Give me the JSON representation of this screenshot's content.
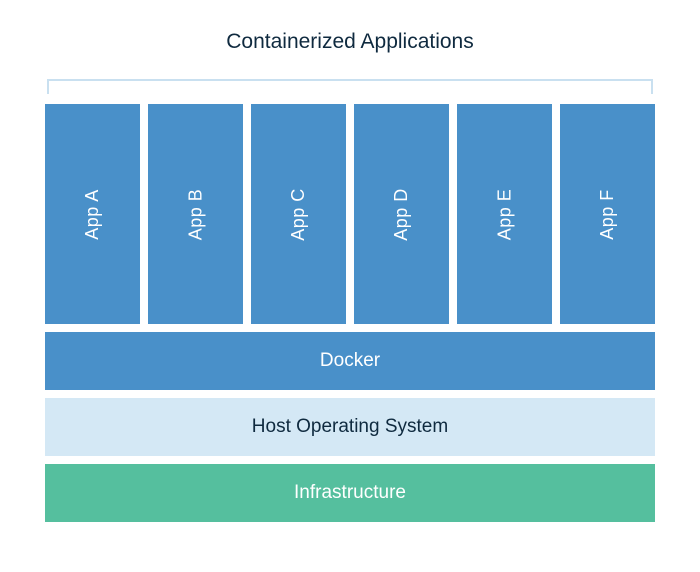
{
  "title": "Containerized Applications",
  "apps": [
    {
      "label": "App A"
    },
    {
      "label": "App B"
    },
    {
      "label": "App C"
    },
    {
      "label": "App D"
    },
    {
      "label": "App E"
    },
    {
      "label": "App F"
    }
  ],
  "layers": {
    "docker": "Docker",
    "os": "Host Operating System",
    "infrastructure": "Infrastructure"
  },
  "colors": {
    "app_box": "#4990c9",
    "docker": "#4990c9",
    "os_bg": "#d4e8f5",
    "os_text": "#0f2a3f",
    "infrastructure": "#55bf9e",
    "title_text": "#0f2a3f",
    "bracket": "#c9e0f0"
  }
}
